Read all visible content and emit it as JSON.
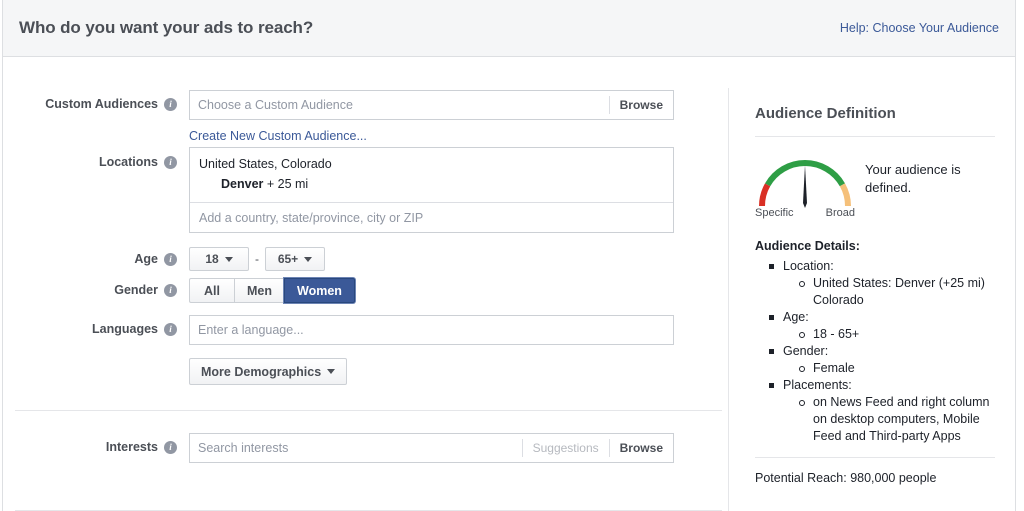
{
  "header": {
    "title": "Who do you want your ads to reach?",
    "help_link": "Help: Choose Your Audience"
  },
  "form": {
    "custom_audiences": {
      "label": "Custom Audiences",
      "info_icon": "info-icon",
      "placeholder": "Choose a Custom Audience",
      "browse_label": "Browse",
      "create_link": "Create New Custom Audience..."
    },
    "locations": {
      "label": "Locations",
      "info_icon": "info-icon",
      "country_state": "United States, Colorado",
      "city": "Denver",
      "radius": "+ 25 mi",
      "placeholder": "Add a country, state/province, city or ZIP"
    },
    "age": {
      "label": "Age",
      "info_icon": "info-icon",
      "min": "18",
      "max": "65+",
      "separator": "-",
      "caret_icon": "chevron-down-icon"
    },
    "gender": {
      "label": "Gender",
      "info_icon": "info-icon",
      "options": [
        "All",
        "Men",
        "Women"
      ],
      "selected": "Women"
    },
    "languages": {
      "label": "Languages",
      "info_icon": "info-icon",
      "placeholder": "Enter a language..."
    },
    "more_demographics": {
      "label": "More Demographics",
      "caret_icon": "chevron-down-icon"
    },
    "interests": {
      "label": "Interests",
      "info_icon": "info-icon",
      "placeholder": "Search interests",
      "suggestions_label": "Suggestions",
      "browse_label": "Browse"
    }
  },
  "audience": {
    "title": "Audience Definition",
    "gauge": {
      "left_label": "Specific",
      "right_label": "Broad",
      "needle_angle_deg": 0,
      "colors": {
        "specific": "#d93025",
        "defined": "#2e9e45",
        "broad": "#f5c07a",
        "needle": "#1d2129"
      }
    },
    "status_message": "Your audience is defined.",
    "details_title": "Audience Details:",
    "details": [
      {
        "label": "Location:",
        "values": [
          "United States: Denver (+25 mi) Colorado"
        ]
      },
      {
        "label": "Age:",
        "values": [
          "18 - 65+"
        ]
      },
      {
        "label": "Gender:",
        "values": [
          "Female"
        ]
      },
      {
        "label": "Placements:",
        "values": [
          "on News Feed and right column on desktop computers, Mobile Feed and Third-party Apps"
        ]
      }
    ],
    "potential_reach": "Potential Reach: 980,000 people"
  }
}
